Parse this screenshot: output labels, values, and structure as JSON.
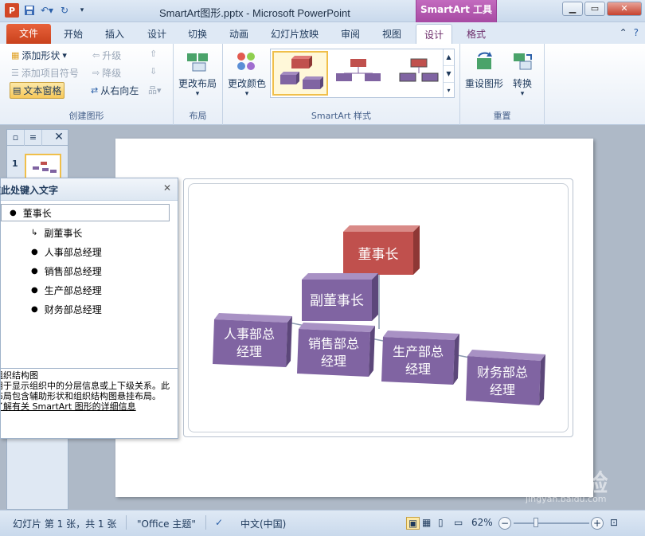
{
  "window": {
    "title": "SmartArt图形.pptx - Microsoft PowerPoint",
    "context_tab_title": "SmartArt 工具"
  },
  "tabs": {
    "file": "文件",
    "items": [
      "开始",
      "插入",
      "设计",
      "切换",
      "动画",
      "幻灯片放映",
      "审阅",
      "视图"
    ],
    "context_items": [
      "设计",
      "格式"
    ],
    "active": "设计"
  },
  "ribbon": {
    "create_graphic": {
      "label": "创建图形",
      "add_shape": "添加形状",
      "add_bullet": "添加项目符号",
      "text_pane": "文本窗格",
      "promote": "升级",
      "demote": "降级",
      "right_to_left": "从右向左"
    },
    "layouts": {
      "label": "布局",
      "change_layout": "更改布局"
    },
    "smartart_styles": {
      "label": "SmartArt 样式",
      "change_colors": "更改颜色"
    },
    "reset": {
      "label": "重置",
      "reset_graphic": "重设图形",
      "convert": "转换"
    }
  },
  "colors": {
    "top_box": "#c0504d",
    "purple_box": "#8064a2",
    "file_tab": "#d24726",
    "context_tab": "#b255ae"
  },
  "slides_pane": {
    "slide_number": "1"
  },
  "smartart": {
    "top": "董事长",
    "assistant": "副董事长",
    "children": [
      "人事部总经理",
      "销售部总经理",
      "生产部总经理",
      "财务部总经理"
    ],
    "children_lines": [
      [
        "人事部总",
        "经理"
      ],
      [
        "销售部总",
        "经理"
      ],
      [
        "生产部总",
        "经理"
      ],
      [
        "财务部总",
        "经理"
      ]
    ]
  },
  "text_pane": {
    "title": "在此处键入文字",
    "items": [
      "董事长",
      "副董事长",
      "人事部总经理",
      "销售部总经理",
      "生产部总经理",
      "财务部总经理"
    ],
    "desc_title": "组织结构图",
    "desc_body": "用于显示组织中的分层信息或上下级关系。此布局包含辅助形状和组织结构图悬挂布局。",
    "desc_link": "了解有关 SmartArt 图形的详细信息"
  },
  "status": {
    "slide_info": "幻灯片 第 1 张，共 1 张",
    "theme": "\"Office 主题\"",
    "language": "中文(中国)",
    "zoom": "62%"
  },
  "watermark": {
    "brand": "Baidu经验",
    "sub": "jingyan.baidu.com"
  }
}
